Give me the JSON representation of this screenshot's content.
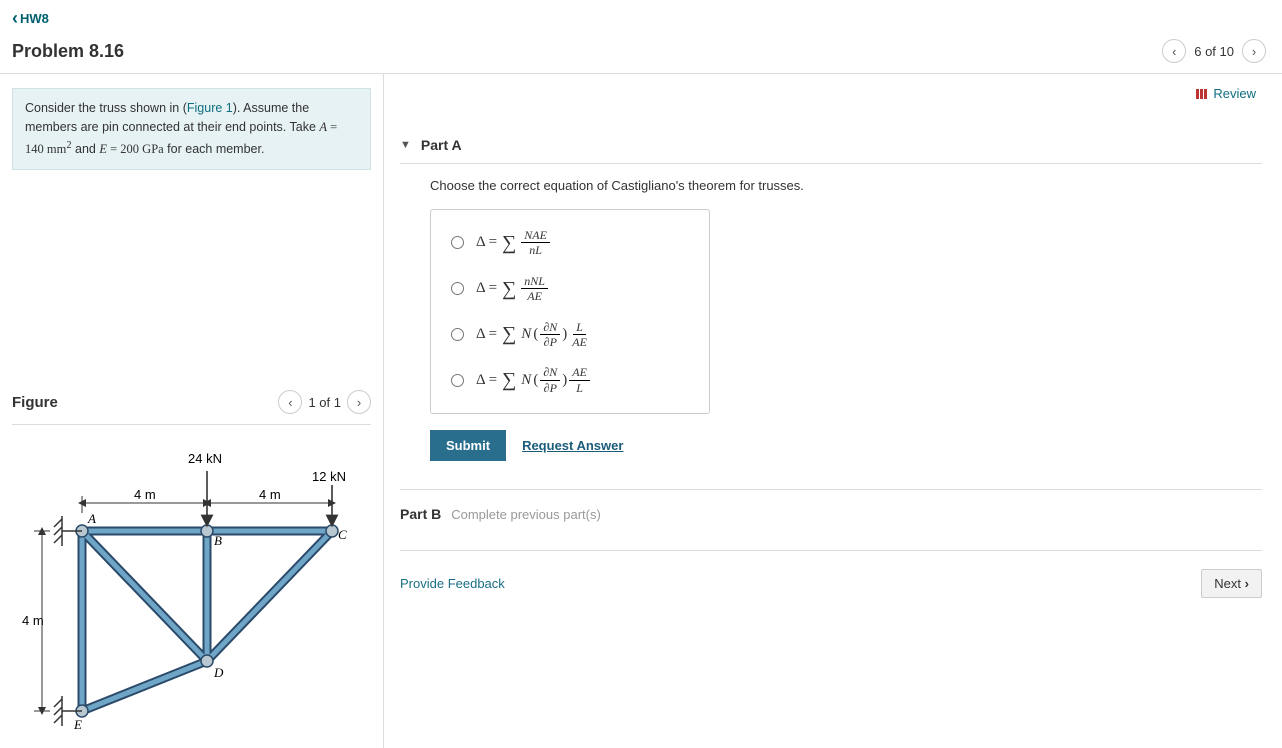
{
  "back_link": "HW8",
  "problem_title": "Problem 8.16",
  "pager": {
    "label": "6 of 10"
  },
  "intro": {
    "pre": "Consider the truss shown in (",
    "fig_link": "Figure 1",
    "post": "). Assume the members are pin connected at their end points. Take ",
    "eq_A": "A",
    "eq_A_val": " = 140 ",
    "unit_mm2_base": "mm",
    "eq_and": " and ",
    "eq_E": "E",
    "eq_E_val": " = 200 ",
    "unit_GPa": "GPa",
    "eq_tail": " for each member."
  },
  "figure": {
    "heading": "Figure",
    "pager": "1 of 1"
  },
  "figure_labels": {
    "top_force": "24 kN",
    "right_force": "12 kN",
    "span_left": "4 m",
    "span_right": "4 m",
    "height": "4 m",
    "A": "A",
    "B": "B",
    "C": "C",
    "D": "D",
    "E": "E"
  },
  "review_label": "Review",
  "partA": {
    "label": "Part A",
    "question": "Choose the correct equation of Castigliano's theorem for trusses.",
    "options": {
      "o1": {
        "num": "NAE",
        "den": "nL"
      },
      "o2": {
        "num": "nNL",
        "den": "AE"
      },
      "o3": {
        "left_num": "∂N",
        "left_den": "∂P",
        "right_num": "L",
        "right_den": "AE"
      },
      "o4": {
        "left_num": "∂N",
        "left_den": "∂P",
        "right_num": "AE",
        "right_den": "L"
      }
    },
    "submit": "Submit",
    "request": "Request Answer"
  },
  "partB": {
    "label": "Part B",
    "hint": "Complete previous part(s)"
  },
  "feedback": "Provide Feedback",
  "next": "Next"
}
